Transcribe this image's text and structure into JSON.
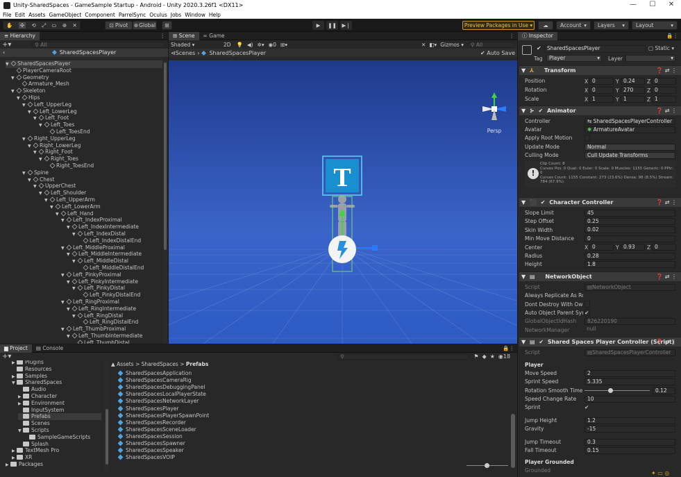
{
  "window": {
    "title": "Unity-SharedSpaces - GameSample Startup - Android - Unity 2020.3.26f1 <DX11>"
  },
  "menu": [
    "File",
    "Edit",
    "Assets",
    "GameObject",
    "Component",
    "ParrelSync",
    "Oculus",
    "Jobs",
    "Window",
    "Help"
  ],
  "toolbar": {
    "pivot": "Pivot",
    "global": "Global",
    "preview": "Preview Packages in Use ▾",
    "account": "Account",
    "layers": "Layers",
    "layout": "Layout"
  },
  "hierarchy": {
    "tab": "Hierarchy",
    "search_placeholder": "All",
    "header": "SharedSpacesPlayer",
    "items": [
      {
        "label": "SharedSpacesPlayer",
        "depth": 0,
        "arrow": "▼"
      },
      {
        "label": "PlayerCameraRoot",
        "depth": 1,
        "arrow": ""
      },
      {
        "label": "Geometry",
        "depth": 1,
        "arrow": "▼"
      },
      {
        "label": "Armature_Mesh",
        "depth": 2,
        "arrow": ""
      },
      {
        "label": "Skeleton",
        "depth": 1,
        "arrow": "▼"
      },
      {
        "label": "Hips",
        "depth": 2,
        "arrow": "▼"
      },
      {
        "label": "Left_UpperLeg",
        "depth": 3,
        "arrow": "▼"
      },
      {
        "label": "Left_LowerLeg",
        "depth": 4,
        "arrow": "▼"
      },
      {
        "label": "Left_Foot",
        "depth": 5,
        "arrow": "▼"
      },
      {
        "label": "Left_Toes",
        "depth": 6,
        "arrow": "▼"
      },
      {
        "label": "Left_ToesEnd",
        "depth": 7,
        "arrow": ""
      },
      {
        "label": "Right_UpperLeg",
        "depth": 3,
        "arrow": "▼"
      },
      {
        "label": "Right_LowerLeg",
        "depth": 4,
        "arrow": "▼"
      },
      {
        "label": "Right_Foot",
        "depth": 5,
        "arrow": "▼"
      },
      {
        "label": "Right_Toes",
        "depth": 6,
        "arrow": "▼"
      },
      {
        "label": "Right_ToesEnd",
        "depth": 7,
        "arrow": ""
      },
      {
        "label": "Spine",
        "depth": 3,
        "arrow": "▼"
      },
      {
        "label": "Chest",
        "depth": 4,
        "arrow": "▼"
      },
      {
        "label": "UpperChest",
        "depth": 5,
        "arrow": "▼"
      },
      {
        "label": "Left_Shoulder",
        "depth": 6,
        "arrow": "▼"
      },
      {
        "label": "Left_UpperArm",
        "depth": 7,
        "arrow": "▼"
      },
      {
        "label": "Left_LowerArm",
        "depth": 8,
        "arrow": "▼"
      },
      {
        "label": "Left_Hand",
        "depth": 9,
        "arrow": "▼"
      },
      {
        "label": "Left_IndexProximal",
        "depth": 10,
        "arrow": "▼"
      },
      {
        "label": "Left_IndexIntermediate",
        "depth": 11,
        "arrow": "▼"
      },
      {
        "label": "Left_IndexDistal",
        "depth": 12,
        "arrow": "▼"
      },
      {
        "label": "Left_IndexDistalEnd",
        "depth": 13,
        "arrow": ""
      },
      {
        "label": "Left_MiddleProximal",
        "depth": 10,
        "arrow": "▼"
      },
      {
        "label": "Left_MiddleIntermediate",
        "depth": 11,
        "arrow": "▼"
      },
      {
        "label": "Left_MiddleDistal",
        "depth": 12,
        "arrow": "▼"
      },
      {
        "label": "Left_MiddleDistalEnd",
        "depth": 13,
        "arrow": ""
      },
      {
        "label": "Left_PinkyProximal",
        "depth": 10,
        "arrow": "▼"
      },
      {
        "label": "Left_PinkyIntermediate",
        "depth": 11,
        "arrow": "▼"
      },
      {
        "label": "Left_PinkyDistal",
        "depth": 12,
        "arrow": "▼"
      },
      {
        "label": "Left_PinkyDistalEnd",
        "depth": 13,
        "arrow": ""
      },
      {
        "label": "Left_RingProximal",
        "depth": 10,
        "arrow": "▼"
      },
      {
        "label": "Left_RingIntermediate",
        "depth": 11,
        "arrow": "▼"
      },
      {
        "label": "Left_RingDistal",
        "depth": 12,
        "arrow": "▼"
      },
      {
        "label": "Left_RingDistalEnd",
        "depth": 13,
        "arrow": ""
      },
      {
        "label": "Left_ThumbProximal",
        "depth": 10,
        "arrow": "▼"
      },
      {
        "label": "Left_ThumbIntermediate",
        "depth": 11,
        "arrow": "▼"
      },
      {
        "label": "Left_ThumbDistal",
        "depth": 12,
        "arrow": ""
      }
    ]
  },
  "scene": {
    "tab_scene": "Scene",
    "tab_game": "Game",
    "shading": "Shaded",
    "mode_2d": "2D",
    "gizmos": "Gizmos",
    "search_placeholder": "All",
    "breadcrumb_root": "Scenes",
    "breadcrumb_obj": "SharedSpacesPlayer",
    "auto_save": "Auto Save",
    "persp": "Persp"
  },
  "project": {
    "tab_project": "Project",
    "tab_console": "Console",
    "path": [
      "Assets",
      "SharedSpaces",
      "Prefabs"
    ],
    "count": "18",
    "tree": [
      {
        "label": "Plugins",
        "depth": 1
      },
      {
        "label": "Resources",
        "depth": 1
      },
      {
        "label": "Samples",
        "depth": 1
      },
      {
        "label": "SharedSpaces",
        "depth": 1
      },
      {
        "label": "Audio",
        "depth": 2
      },
      {
        "label": "Character",
        "depth": 2
      },
      {
        "label": "Environment",
        "depth": 2
      },
      {
        "label": "InputSystem",
        "depth": 2
      },
      {
        "label": "Prefabs",
        "depth": 2
      },
      {
        "label": "Scenes",
        "depth": 2
      },
      {
        "label": "Scripts",
        "depth": 2
      },
      {
        "label": "SampleGameScripts",
        "depth": 3
      },
      {
        "label": "Splash",
        "depth": 2
      },
      {
        "label": "TextMesh Pro",
        "depth": 1
      },
      {
        "label": "XR",
        "depth": 1
      },
      {
        "label": "Packages",
        "depth": 0
      }
    ],
    "files": [
      "SharedSpacesApplication",
      "SharedSpacesCameraRig",
      "SharedSpacesDebuggingPanel",
      "SharedSpacesLocalPlayerState",
      "SharedSpacesNetworkLayer",
      "SharedSpacesPlayer",
      "SharedSpacesPlayerSpawnPoint",
      "SharedSpacesRecorder",
      "SharedSpacesSceneLoader",
      "SharedSpacesSession",
      "SharedSpacesSpawner",
      "SharedSpacesSpeaker",
      "SharedSpacesVOIP"
    ]
  },
  "inspector": {
    "tab": "Inspector",
    "object_name": "SharedSpacesPlayer",
    "static": "Static",
    "tag_label": "Tag",
    "tag": "Player",
    "layer_label": "Layer",
    "transform": {
      "title": "Transform",
      "position": [
        "0",
        "0.24",
        "0"
      ],
      "rotation": [
        "0",
        "270",
        "0"
      ],
      "scale": [
        "1",
        "1",
        "1"
      ],
      "labels": [
        "Position",
        "Rotation",
        "Scale"
      ]
    },
    "animator": {
      "title": "Animator",
      "controller": "SharedSpacesPlayerController",
      "avatar": "ArmatureAvatar",
      "update_mode": "Normal",
      "culling_mode": "Cull Update Transforms",
      "labels": [
        "Controller",
        "Avatar",
        "Apply Root Motion",
        "Update Mode",
        "Culling Mode"
      ],
      "info": [
        "Clip Count: 8",
        "Curves Pos: 0 Quat: 0 Euler: 0 Scale: 0 Muscles: 1155 Generic: 0 PPtr: 0",
        "Curves Count: 1155 Constant: 273 (23.6%) Dense: 98 (8.5%) Stream: 784 (67.9%)"
      ]
    },
    "cc": {
      "title": "Character Controller",
      "labels": [
        "Slope Limit",
        "Step Offset",
        "Skin Width",
        "Min Move Distance",
        "Center",
        "Radius",
        "Height"
      ],
      "values": [
        "45",
        "0.25",
        "0.02",
        "0",
        "",
        "0.28",
        "1.8"
      ],
      "center": [
        "0",
        "0.93",
        "0"
      ]
    },
    "netobj": {
      "title": "NetworkObject",
      "labels": [
        "Script",
        "Always Replicate As Ro",
        "Dont Destroy With Own",
        "Auto Object Parent Syn",
        "GlobalObjectIdHash",
        "NetworkManager"
      ],
      "script": "NetworkObject",
      "hash": "826220190",
      "manager": "null"
    },
    "sspc": {
      "title": "Shared Spaces Player Controller (Script)",
      "script": "SharedSpacesPlayerController",
      "player_header": "Player",
      "labels": [
        "Move Speed",
        "Sprint Speed",
        "Rotation Smooth Time",
        "Speed Change Rate",
        "Sprint",
        "Jump Height",
        "Gravity",
        "Jump Timeout",
        "Fall Timeout"
      ],
      "values": [
        "2",
        "5.335",
        "0.12",
        "10",
        "",
        "1.2",
        "-15",
        "0.3",
        "0.15"
      ],
      "grounded_header": "Player Grounded",
      "grounded": "Grounded"
    }
  }
}
